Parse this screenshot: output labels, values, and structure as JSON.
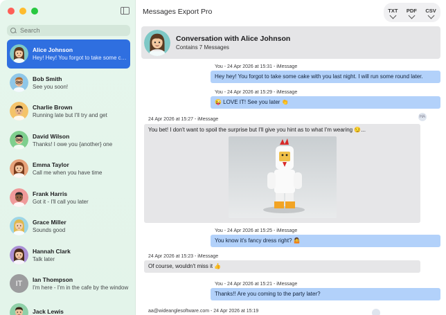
{
  "window": {
    "traffic_colors": [
      "#ff5f57",
      "#febc2e",
      "#28c840"
    ],
    "app_title": "Messages Export Pro"
  },
  "exports": [
    {
      "label": "TXT"
    },
    {
      "label": "PDF"
    },
    {
      "label": "CSV"
    }
  ],
  "search": {
    "placeholder": "Search"
  },
  "contacts": [
    {
      "name": "Alice Johnson",
      "preview": "Hey! Hey! You forgot to take some cake with you last night",
      "avatar": "alice-avatar",
      "active": true
    },
    {
      "name": "Bob Smith",
      "preview": "See you soon!",
      "avatar": "bob-avatar"
    },
    {
      "name": "Charlie Brown",
      "preview": "Running late but I'll try and get",
      "avatar": "charlie-avatar"
    },
    {
      "name": "David Wilson",
      "preview": "Thanks! I owe you {another} one",
      "avatar": "david-avatar"
    },
    {
      "name": "Emma Taylor",
      "preview": "Call me when you have time",
      "avatar": "emma-avatar"
    },
    {
      "name": "Frank Harris",
      "preview": "Got it - I'll call you later",
      "avatar": "frank-avatar"
    },
    {
      "name": "Grace Miller",
      "preview": "Sounds good",
      "avatar": "grace-avatar"
    },
    {
      "name": "Hannah Clark",
      "preview": "Talk later",
      "avatar": "hannah-avatar"
    },
    {
      "name": "Ian Thompson",
      "preview": "I'm here - I'm in the cafe by the window",
      "avatar": "initials",
      "initials": "IT"
    },
    {
      "name": "Jack Lewis",
      "preview": "",
      "avatar": "jack-avatar"
    }
  ],
  "conversation": {
    "title": "Conversation with Alice Johnson",
    "subtitle": "Contains 7 Messages"
  },
  "messages": [
    {
      "dir": "out",
      "meta": "You - 24 Apr 2026 at 15:31 - iMessage",
      "text": "Hey hey! You forgot to take some cake with you last night. I will run some round later."
    },
    {
      "dir": "out",
      "meta": "You - 24 Apr 2026 at 15:29 - iMessage",
      "text": "😜 LOVE IT! See you later 👏"
    },
    {
      "dir": "in",
      "meta": "24 Apr 2026 at 15:27 - iMessage",
      "text": "You bet! I don't want to spoil the surprise but I'll give you hint as to what I'm wearing 😏...",
      "tapback": "HA"
    },
    {
      "dir": "out",
      "meta": "You - 24 Apr 2026 at 15:25 - iMessage",
      "text": "You know it's fancy dress right? 🤷"
    },
    {
      "dir": "in",
      "meta": "24 Apr 2026 at 15:23 - iMessage",
      "text": "Of course, wouldn't miss it 👍"
    },
    {
      "dir": "out",
      "meta": "You - 24 Apr 2026 at 15:21 - iMessage",
      "text": "Thanks!! Are you coming to the party later?"
    },
    {
      "dir": "in",
      "meta": "aa@wideanglesoftware.com - 24 Apr 2026 at 15:19",
      "text": ""
    }
  ]
}
